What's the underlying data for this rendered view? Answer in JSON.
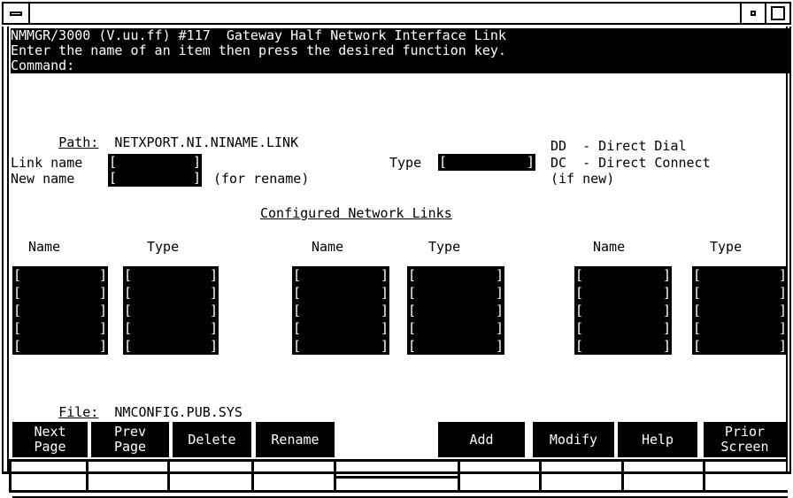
{
  "window": {
    "title": "",
    "controls": {
      "minimize": "minimize",
      "restore": "restore",
      "maximize": "maximize"
    }
  },
  "header": {
    "title_line": "NMMGR/3000 (V.uu.ff) #117  Gateway Half Network Interface Link",
    "instruction_line": "Enter the name of an item then press the desired function key.",
    "command_label": "Command:",
    "command_value": ""
  },
  "path": {
    "label": "Path:",
    "value": "NETXPORT.NI.NINAME.LINK"
  },
  "form": {
    "link_name_label": "Link name",
    "link_name_value": "",
    "new_name_label": "New name",
    "new_name_value": "",
    "new_name_hint": "(for rename)",
    "type_label": "Type",
    "type_value": ""
  },
  "legend": {
    "lines": [
      "DD  - Direct Dial",
      "DC  - Direct Connect",
      "(if new)"
    ]
  },
  "table": {
    "title": "Configured Network Links",
    "columns": [
      {
        "name_header": "Name",
        "type_header": "Type"
      },
      {
        "name_header": "Name",
        "type_header": "Type"
      },
      {
        "name_header": "Name",
        "type_header": "Type"
      }
    ],
    "rows": 5,
    "cells": {
      "group1_name": [
        "",
        "",
        "",
        "",
        ""
      ],
      "group1_type": [
        "",
        "",
        "",
        "",
        ""
      ],
      "group2_name": [
        "",
        "",
        "",
        "",
        ""
      ],
      "group2_type": [
        "",
        "",
        "",
        "",
        ""
      ],
      "group3_name": [
        "",
        "",
        "",
        "",
        ""
      ],
      "group3_type": [
        "",
        "",
        "",
        "",
        ""
      ]
    }
  },
  "file": {
    "label": "File:",
    "value": "NMCONFIG.PUB.SYS"
  },
  "function_keys": [
    {
      "line1": "Next",
      "line2": "Page"
    },
    {
      "line1": "Prev",
      "line2": "Page"
    },
    {
      "line1": "Delete",
      "line2": ""
    },
    {
      "line1": "Rename",
      "line2": ""
    },
    {
      "line1": "Add",
      "line2": ""
    },
    {
      "line1": "Modify",
      "line2": ""
    },
    {
      "line1": "Help",
      "line2": ""
    },
    {
      "line1": "Prior",
      "line2": "Screen"
    }
  ],
  "colors": {
    "background": "#ffffff",
    "foreground": "#000000",
    "inverse_background": "#000000",
    "inverse_foreground": "#ffffff"
  },
  "brackets": {
    "left": "[",
    "right": "]"
  }
}
